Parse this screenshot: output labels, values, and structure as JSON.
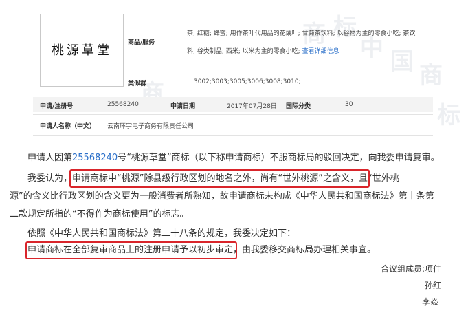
{
  "trademark_card": {
    "logo_text": "桃源草堂",
    "goods_label": "商品/服务",
    "goods_line1": "茶; 红糖; 蜂蜜; 用作茶叶代用品的花或叶; 甘菊茶饮料; 以谷物为主的零食小吃; 茶饮",
    "goods_line2": "料; 谷类制品; 西米; 以米为主的零食小吃;",
    "goods_more_link": "查看详细信息",
    "similar_group_label": "类似群",
    "similar_group_value": "3002;3003;3005;3006;3008;3010;",
    "reg_no_label": "申请/注册号",
    "reg_no_value": "25568240",
    "apply_date_label": "申请日期",
    "apply_date_value": "2017年07月28日",
    "intl_class_label": "国际分类",
    "intl_class_value": "30",
    "applicant_label": "申请人名称（中文）",
    "applicant_value": "云南环宇电子商务有限责任公司",
    "watermark_chars": [
      "商",
      "标",
      "中",
      "国",
      "商",
      "标"
    ]
  },
  "body": {
    "p1_prefix": "申请人因第",
    "p1_number": "25568240",
    "p1_suffix": "号“桃源草堂”商标（以下称申请商标）不服商标局的驳回决定，向我委申请复审。",
    "p2_line1_a": "我委认为，",
    "p2_line1_highlight": "申请商标中“桃源”除县级行政区划的地名之外，尚有“世外桃源”之含义",
    "p2_line1_b": "，且“世外桃",
    "p2_line2": "源”的含义比行政区划的含义更为一般消费者所熟知，故申请商标未构成《中华人民共和国商标法》第十条第",
    "p2_line3": "二款规定所指的“不得作为商标使用”的标志。",
    "p3": "依照《中华人民共和国商标法》第二十八条的规定，我委决定如下：",
    "p4_highlight": "申请商标在全部复审商品上的注册申请予以初步审定",
    "p4_rest": "，由我委移交商标局办理相关事宜。",
    "panel_label": "合议组成员:项佳",
    "member2": "孙红",
    "member3": "李焱"
  }
}
